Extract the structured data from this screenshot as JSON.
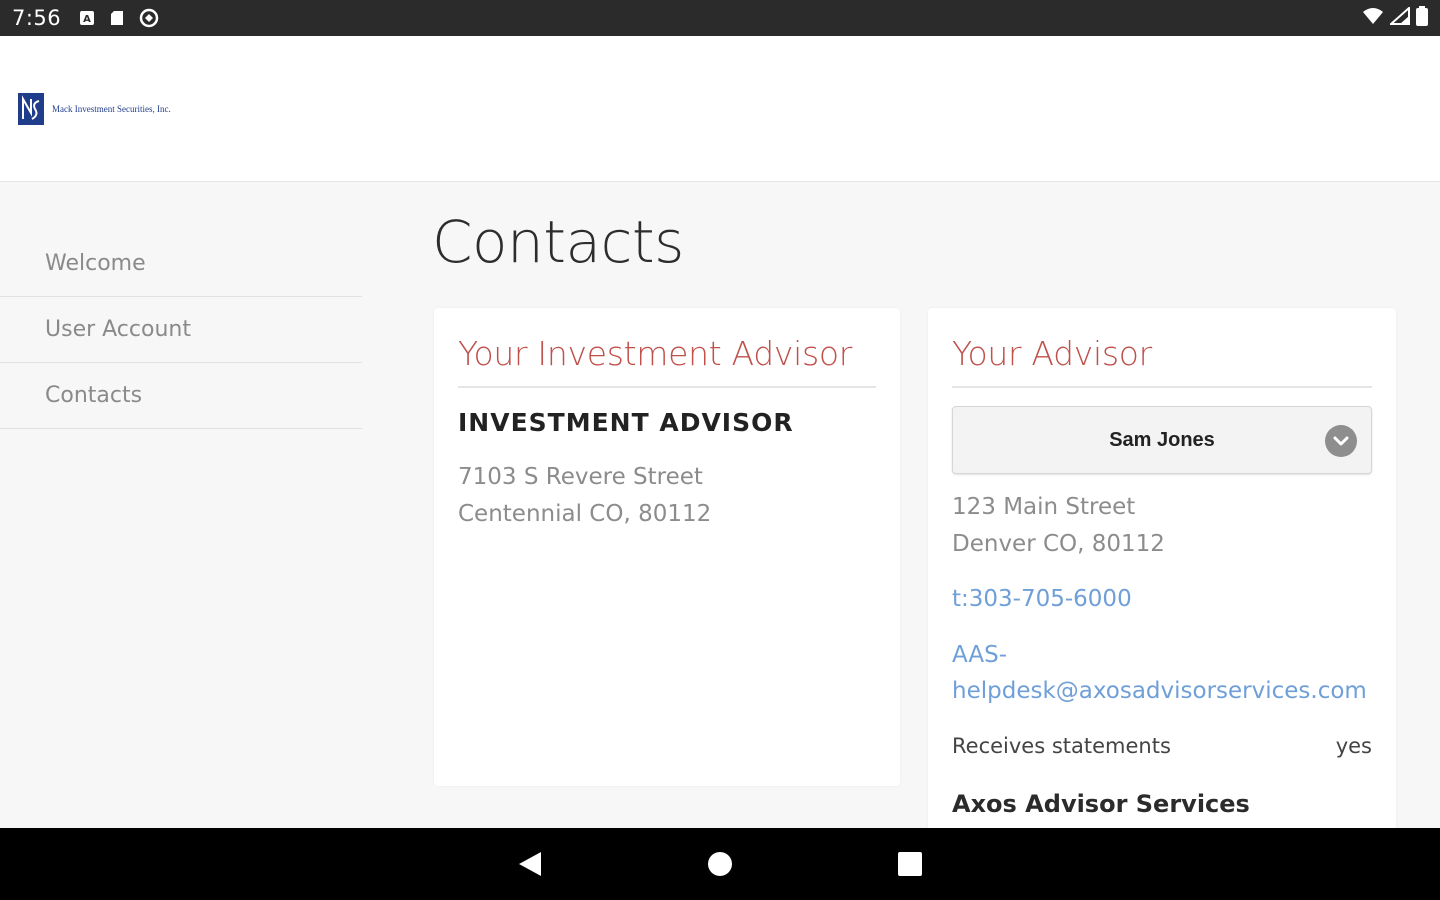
{
  "status_bar": {
    "time": "7:56",
    "left_icons": [
      "notification-a-icon",
      "sd-card-icon",
      "sync-icon"
    ],
    "right_icons": [
      "wifi-icon",
      "signal-icon",
      "battery-icon"
    ]
  },
  "header": {
    "logo_mark": "MIS",
    "logo_text": "Mack Investment Securities, Inc."
  },
  "sidebar": {
    "items": [
      {
        "label": "Welcome"
      },
      {
        "label": "User Account"
      },
      {
        "label": "Contacts"
      }
    ]
  },
  "page": {
    "title": "Contacts"
  },
  "investment_advisor_card": {
    "heading": "Your Investment Advisor",
    "name": "INVESTMENT ADVISOR",
    "address_line1": "7103 S Revere Street",
    "address_line2": "Centennial CO, 80112"
  },
  "advisor_card": {
    "heading": "Your Advisor",
    "selected_advisor": "Sam Jones",
    "address_line1": "123 Main Street",
    "address_line2": "Denver CO, 80112",
    "phone": "t:303-705-6000",
    "email_line1": "AAS-",
    "email_line2": "helpdesk@axosadvisorservices.com",
    "statements_label": "Receives statements",
    "statements_value": "yes",
    "company": "Axos Advisor Services"
  },
  "colors": {
    "heading_accent": "#c0504a",
    "link": "#6f9fd8",
    "logo_blue": "#1f3d8a"
  }
}
